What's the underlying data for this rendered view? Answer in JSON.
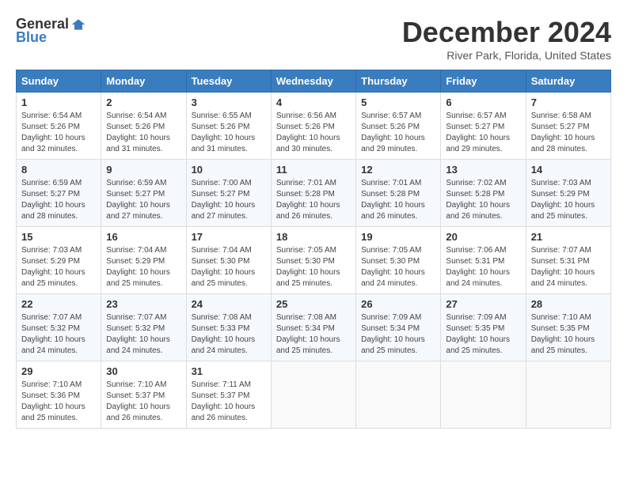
{
  "logo": {
    "general": "General",
    "blue": "Blue"
  },
  "title": "December 2024",
  "location": "River Park, Florida, United States",
  "weekdays": [
    "Sunday",
    "Monday",
    "Tuesday",
    "Wednesday",
    "Thursday",
    "Friday",
    "Saturday"
  ],
  "weeks": [
    [
      {
        "day": "1",
        "sunrise": "6:54 AM",
        "sunset": "5:26 PM",
        "daylight": "10 hours and 32 minutes."
      },
      {
        "day": "2",
        "sunrise": "6:54 AM",
        "sunset": "5:26 PM",
        "daylight": "10 hours and 31 minutes."
      },
      {
        "day": "3",
        "sunrise": "6:55 AM",
        "sunset": "5:26 PM",
        "daylight": "10 hours and 31 minutes."
      },
      {
        "day": "4",
        "sunrise": "6:56 AM",
        "sunset": "5:26 PM",
        "daylight": "10 hours and 30 minutes."
      },
      {
        "day": "5",
        "sunrise": "6:57 AM",
        "sunset": "5:26 PM",
        "daylight": "10 hours and 29 minutes."
      },
      {
        "day": "6",
        "sunrise": "6:57 AM",
        "sunset": "5:27 PM",
        "daylight": "10 hours and 29 minutes."
      },
      {
        "day": "7",
        "sunrise": "6:58 AM",
        "sunset": "5:27 PM",
        "daylight": "10 hours and 28 minutes."
      }
    ],
    [
      {
        "day": "8",
        "sunrise": "6:59 AM",
        "sunset": "5:27 PM",
        "daylight": "10 hours and 28 minutes."
      },
      {
        "day": "9",
        "sunrise": "6:59 AM",
        "sunset": "5:27 PM",
        "daylight": "10 hours and 27 minutes."
      },
      {
        "day": "10",
        "sunrise": "7:00 AM",
        "sunset": "5:27 PM",
        "daylight": "10 hours and 27 minutes."
      },
      {
        "day": "11",
        "sunrise": "7:01 AM",
        "sunset": "5:28 PM",
        "daylight": "10 hours and 26 minutes."
      },
      {
        "day": "12",
        "sunrise": "7:01 AM",
        "sunset": "5:28 PM",
        "daylight": "10 hours and 26 minutes."
      },
      {
        "day": "13",
        "sunrise": "7:02 AM",
        "sunset": "5:28 PM",
        "daylight": "10 hours and 26 minutes."
      },
      {
        "day": "14",
        "sunrise": "7:03 AM",
        "sunset": "5:29 PM",
        "daylight": "10 hours and 25 minutes."
      }
    ],
    [
      {
        "day": "15",
        "sunrise": "7:03 AM",
        "sunset": "5:29 PM",
        "daylight": "10 hours and 25 minutes."
      },
      {
        "day": "16",
        "sunrise": "7:04 AM",
        "sunset": "5:29 PM",
        "daylight": "10 hours and 25 minutes."
      },
      {
        "day": "17",
        "sunrise": "7:04 AM",
        "sunset": "5:30 PM",
        "daylight": "10 hours and 25 minutes."
      },
      {
        "day": "18",
        "sunrise": "7:05 AM",
        "sunset": "5:30 PM",
        "daylight": "10 hours and 25 minutes."
      },
      {
        "day": "19",
        "sunrise": "7:05 AM",
        "sunset": "5:30 PM",
        "daylight": "10 hours and 24 minutes."
      },
      {
        "day": "20",
        "sunrise": "7:06 AM",
        "sunset": "5:31 PM",
        "daylight": "10 hours and 24 minutes."
      },
      {
        "day": "21",
        "sunrise": "7:07 AM",
        "sunset": "5:31 PM",
        "daylight": "10 hours and 24 minutes."
      }
    ],
    [
      {
        "day": "22",
        "sunrise": "7:07 AM",
        "sunset": "5:32 PM",
        "daylight": "10 hours and 24 minutes."
      },
      {
        "day": "23",
        "sunrise": "7:07 AM",
        "sunset": "5:32 PM",
        "daylight": "10 hours and 24 minutes."
      },
      {
        "day": "24",
        "sunrise": "7:08 AM",
        "sunset": "5:33 PM",
        "daylight": "10 hours and 24 minutes."
      },
      {
        "day": "25",
        "sunrise": "7:08 AM",
        "sunset": "5:34 PM",
        "daylight": "10 hours and 25 minutes."
      },
      {
        "day": "26",
        "sunrise": "7:09 AM",
        "sunset": "5:34 PM",
        "daylight": "10 hours and 25 minutes."
      },
      {
        "day": "27",
        "sunrise": "7:09 AM",
        "sunset": "5:35 PM",
        "daylight": "10 hours and 25 minutes."
      },
      {
        "day": "28",
        "sunrise": "7:10 AM",
        "sunset": "5:35 PM",
        "daylight": "10 hours and 25 minutes."
      }
    ],
    [
      {
        "day": "29",
        "sunrise": "7:10 AM",
        "sunset": "5:36 PM",
        "daylight": "10 hours and 25 minutes."
      },
      {
        "day": "30",
        "sunrise": "7:10 AM",
        "sunset": "5:37 PM",
        "daylight": "10 hours and 26 minutes."
      },
      {
        "day": "31",
        "sunrise": "7:11 AM",
        "sunset": "5:37 PM",
        "daylight": "10 hours and 26 minutes."
      },
      null,
      null,
      null,
      null
    ]
  ],
  "labels": {
    "sunrise": "Sunrise:",
    "sunset": "Sunset:",
    "daylight": "Daylight:"
  }
}
